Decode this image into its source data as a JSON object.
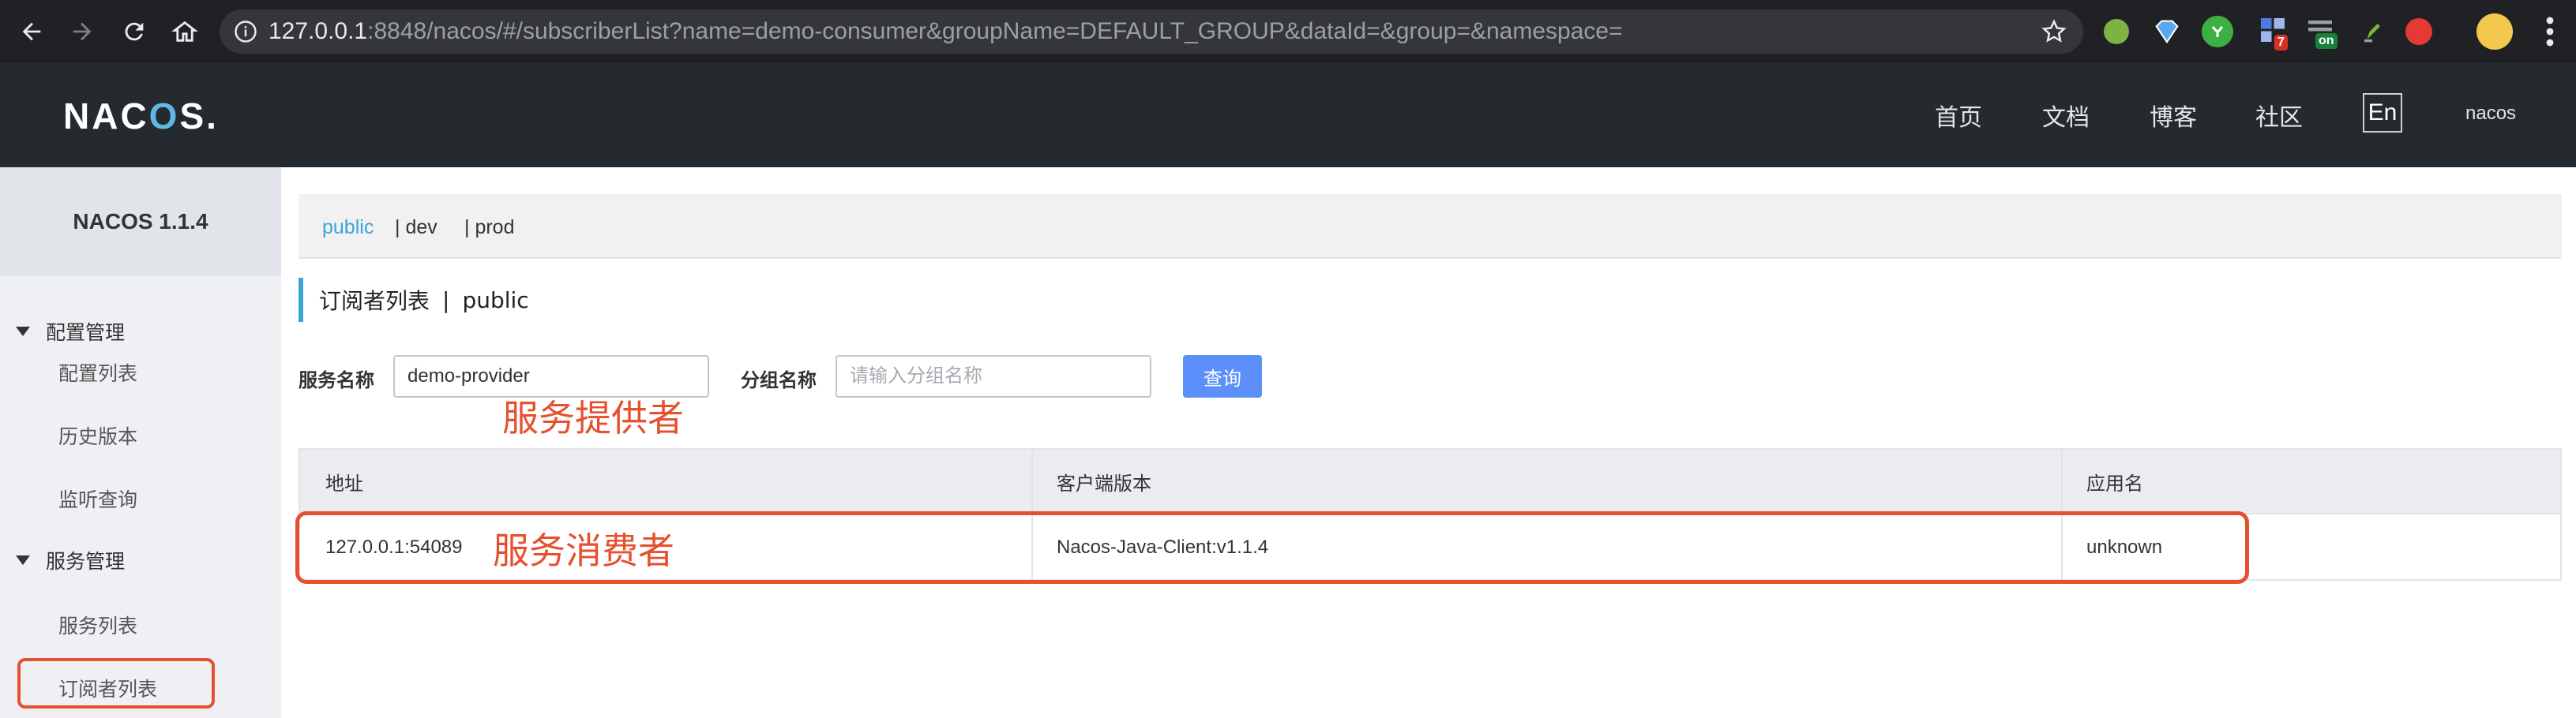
{
  "browser": {
    "url_host": "127.0.0.1",
    "url_rest": ":8848/nacos/#/subscriberList?name=demo-consumer&groupName=DEFAULT_GROUP&dataId=&group=&namespace=",
    "extension_badges": {
      "ext4": "7",
      "ext5": "on"
    },
    "icons": [
      "back-arrow-icon",
      "forward-arrow-icon",
      "reload-icon",
      "home-icon",
      "info-icon",
      "star-icon",
      "menu-dots-icon"
    ]
  },
  "header": {
    "logo_pre": "NAC",
    "logo_o": "O",
    "logo_post": "S.",
    "nav": [
      "首页",
      "文档",
      "博客",
      "社区"
    ],
    "lang": "En",
    "user": "nacos"
  },
  "sidebar": {
    "title": "NACOS 1.1.4",
    "groups": [
      {
        "label": "配置管理",
        "items": [
          "配置列表",
          "历史版本",
          "监听查询"
        ]
      },
      {
        "label": "服务管理",
        "items": [
          "服务列表",
          "订阅者列表"
        ]
      }
    ]
  },
  "namespaces": [
    "public",
    "| dev",
    "| prod"
  ],
  "page": {
    "title": "订阅者列表",
    "separator": "|",
    "namespace": "public"
  },
  "form": {
    "service_label": "服务名称",
    "service_value": "demo-provider",
    "group_label": "分组名称",
    "group_placeholder": "请输入分组名称",
    "query_label": "查询"
  },
  "annotations": {
    "provider": "服务提供者",
    "consumer": "服务消费者"
  },
  "table": {
    "headers": [
      "地址",
      "客户端版本",
      "应用名"
    ],
    "rows": [
      [
        "127.0.0.1:54089",
        "Nacos-Java-Client:v1.1.4",
        "unknown"
      ]
    ]
  },
  "colors": {
    "accent": "#3ba3d8",
    "primary_button": "#5b8ff9",
    "annotation_red": "#e5502f",
    "header_bg": "#252a2f"
  }
}
